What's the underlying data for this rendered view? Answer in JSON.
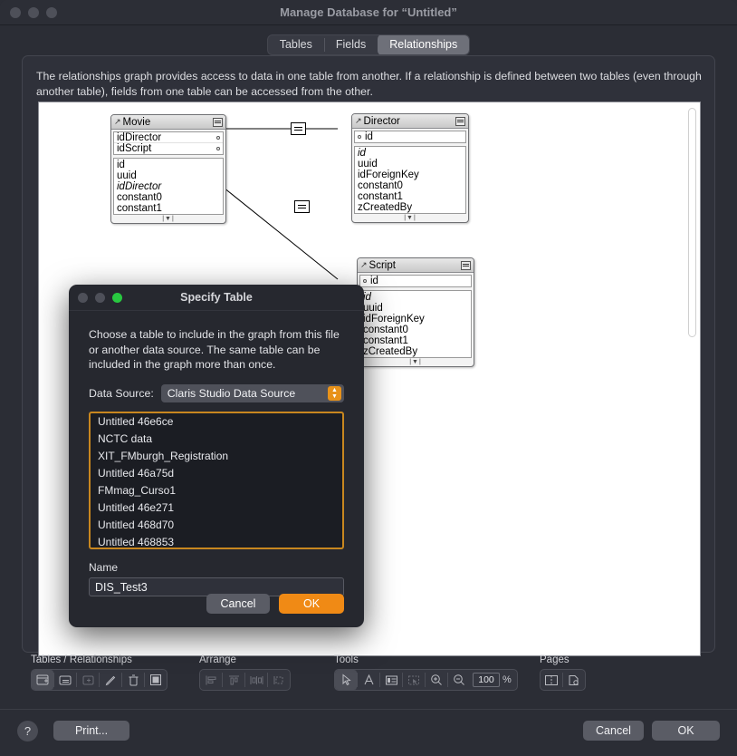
{
  "window": {
    "title": "Manage Database for “Untitled”",
    "traffic_lights": [
      "close-inactive",
      "minimize-inactive",
      "zoom-inactive"
    ]
  },
  "tabs": [
    {
      "label": "Tables",
      "active": false
    },
    {
      "label": "Fields",
      "active": false
    },
    {
      "label": "Relationships",
      "active": true
    }
  ],
  "panel": {
    "description": "The relationships graph provides access to data in one table from another. If a relationship is defined between two tables (even through another table), fields from one table can be accessed from the other."
  },
  "graph": {
    "tables": [
      {
        "name": "Movie",
        "keys": [
          "idDirector",
          "idScript"
        ],
        "fields": [
          "id",
          "uuid",
          "idDirector",
          "constant0",
          "constant1"
        ],
        "italic_fields": [
          "idDirector"
        ]
      },
      {
        "name": "Director",
        "keys": [
          "id"
        ],
        "fields": [
          "id",
          "uuid",
          "idForeignKey",
          "constant0",
          "constant1",
          "zCreatedBy"
        ],
        "italic_fields": [
          "id"
        ]
      },
      {
        "name": "Script",
        "keys": [
          "id"
        ],
        "fields": [
          "id",
          "uuid",
          "idForeignKey",
          "constant0",
          "constant1",
          "zCreatedBy"
        ],
        "italic_fields": [
          "id"
        ]
      }
    ],
    "relationships": [
      {
        "from": "Movie.idDirector",
        "to": "Director.id",
        "operator": "="
      },
      {
        "from": "Movie.idScript",
        "to": "Script.id",
        "operator": "="
      }
    ]
  },
  "toolbar": {
    "groups": [
      {
        "label": "Tables / Relationships",
        "buttons": [
          "add-table-icon",
          "add-relationship-icon",
          "duplicate-icon",
          "edit-icon",
          "delete-icon",
          "color-icon"
        ]
      },
      {
        "label": "Arrange",
        "buttons": [
          "align-left-icon",
          "align-top-icon",
          "distribute-horizontal-icon",
          "resize-icon"
        ]
      },
      {
        "label": "Tools",
        "buttons": [
          "pointer-icon",
          "text-icon",
          "note-icon",
          "selection-icon",
          "zoom-in-icon",
          "zoom-out-icon"
        ],
        "zoom_value": "100",
        "zoom_unit": "%"
      },
      {
        "label": "Pages",
        "buttons": [
          "page-breaks-icon",
          "page-setup-icon"
        ]
      }
    ]
  },
  "bottom_bar": {
    "help": "?",
    "print": "Print...",
    "cancel": "Cancel",
    "ok": "OK"
  },
  "dialog": {
    "title": "Specify Table",
    "traffic_lights": [
      "close-inactive",
      "minimize-inactive",
      "zoom-active"
    ],
    "description": "Choose a table to include in the graph from this file or another data source.  The same table can be included in the graph more than once.",
    "data_source_label": "Data Source:",
    "data_source_value": "Claris Studio Data Source",
    "table_list": [
      "Untitled 46e6ce",
      "NCTC data",
      "XIT_FMburgh_Registration",
      "Untitled 46a75d",
      "FMmag_Curso1",
      "Untitled 46e271",
      "Untitled 468d70",
      "Untitled 468853"
    ],
    "name_label": "Name",
    "name_value": "DIS_Test3",
    "cancel": "Cancel",
    "ok": "OK",
    "accent_color": "#f08a15",
    "list_border_color": "#c8871f"
  }
}
